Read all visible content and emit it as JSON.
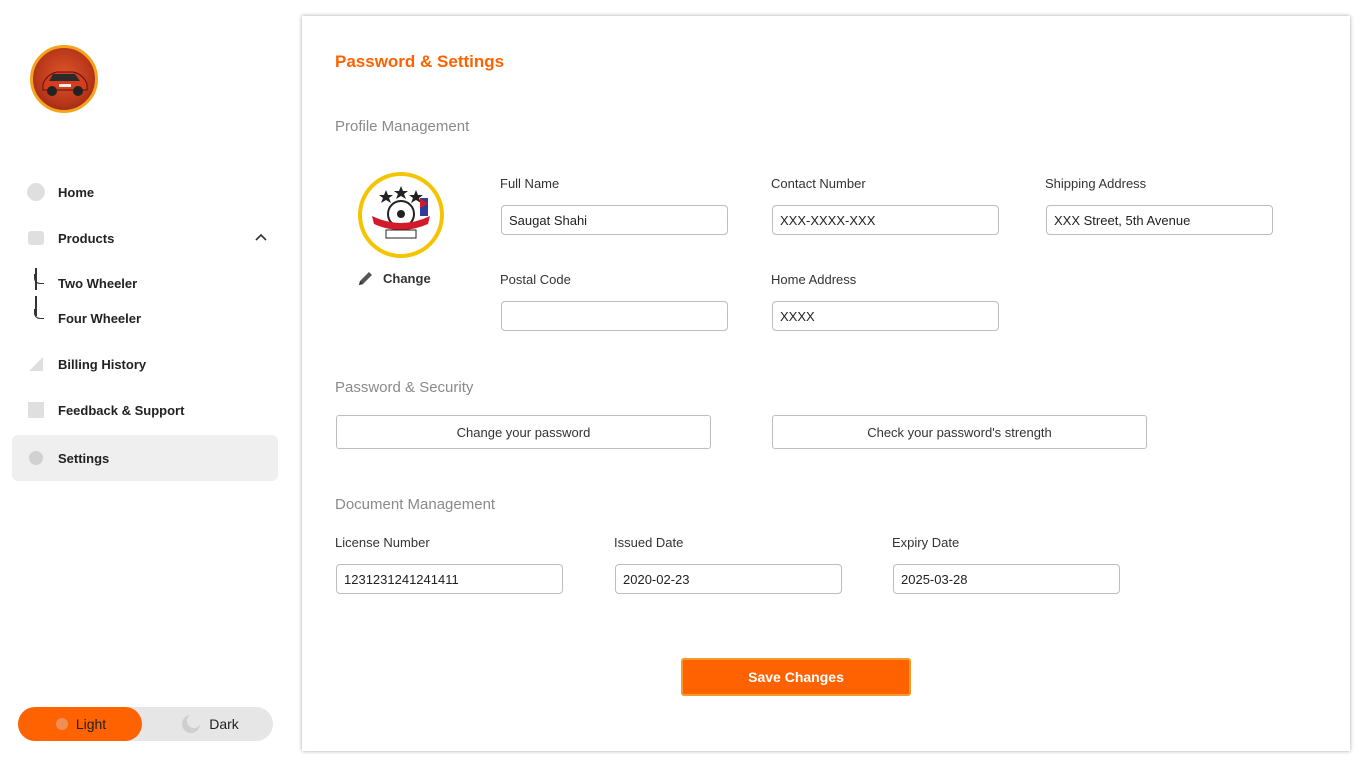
{
  "sidebar": {
    "items": [
      {
        "label": "Home",
        "icon": "home-icon"
      },
      {
        "label": "Products",
        "icon": "products-icon",
        "expanded": true,
        "children": [
          {
            "label": "Two Wheeler"
          },
          {
            "label": "Four Wheeler"
          }
        ]
      },
      {
        "label": "Billing History",
        "icon": "billing-icon"
      },
      {
        "label": "Feedback & Support",
        "icon": "feedback-icon"
      },
      {
        "label": "Settings",
        "icon": "settings-icon",
        "active": true
      }
    ],
    "theme": {
      "light_label": "Light",
      "dark_label": "Dark",
      "selected": "Light"
    }
  },
  "main": {
    "title": "Password & Settings",
    "profile": {
      "section_title": "Profile Management",
      "change_label": "Change",
      "fields": {
        "full_name": {
          "label": "Full Name",
          "value": "Saugat Shahi"
        },
        "contact_number": {
          "label": "Contact Number",
          "value": "XXX-XXXX-XXX"
        },
        "shipping_address": {
          "label": "Shipping Address",
          "value": "XXX Street, 5th Avenue"
        },
        "postal_code": {
          "label": "Postal Code",
          "value": ""
        },
        "home_address": {
          "label": "Home Address",
          "value": "XXXX"
        }
      }
    },
    "security": {
      "section_title": "Password & Security",
      "change_password_label": "Change your password",
      "check_strength_label": "Check your password's strength"
    },
    "documents": {
      "section_title": "Document Management",
      "fields": {
        "license_number": {
          "label": "License Number",
          "value": "1231231241241411"
        },
        "issued_date": {
          "label": "Issued Date",
          "value": "2020-02-23"
        },
        "expiry_date": {
          "label": "Expiry Date",
          "value": "2025-03-28"
        }
      }
    },
    "save_label": "Save Changes"
  },
  "colors": {
    "accent": "#ff6200",
    "active_nav": "#efefef",
    "border": "#bdbdbd"
  }
}
